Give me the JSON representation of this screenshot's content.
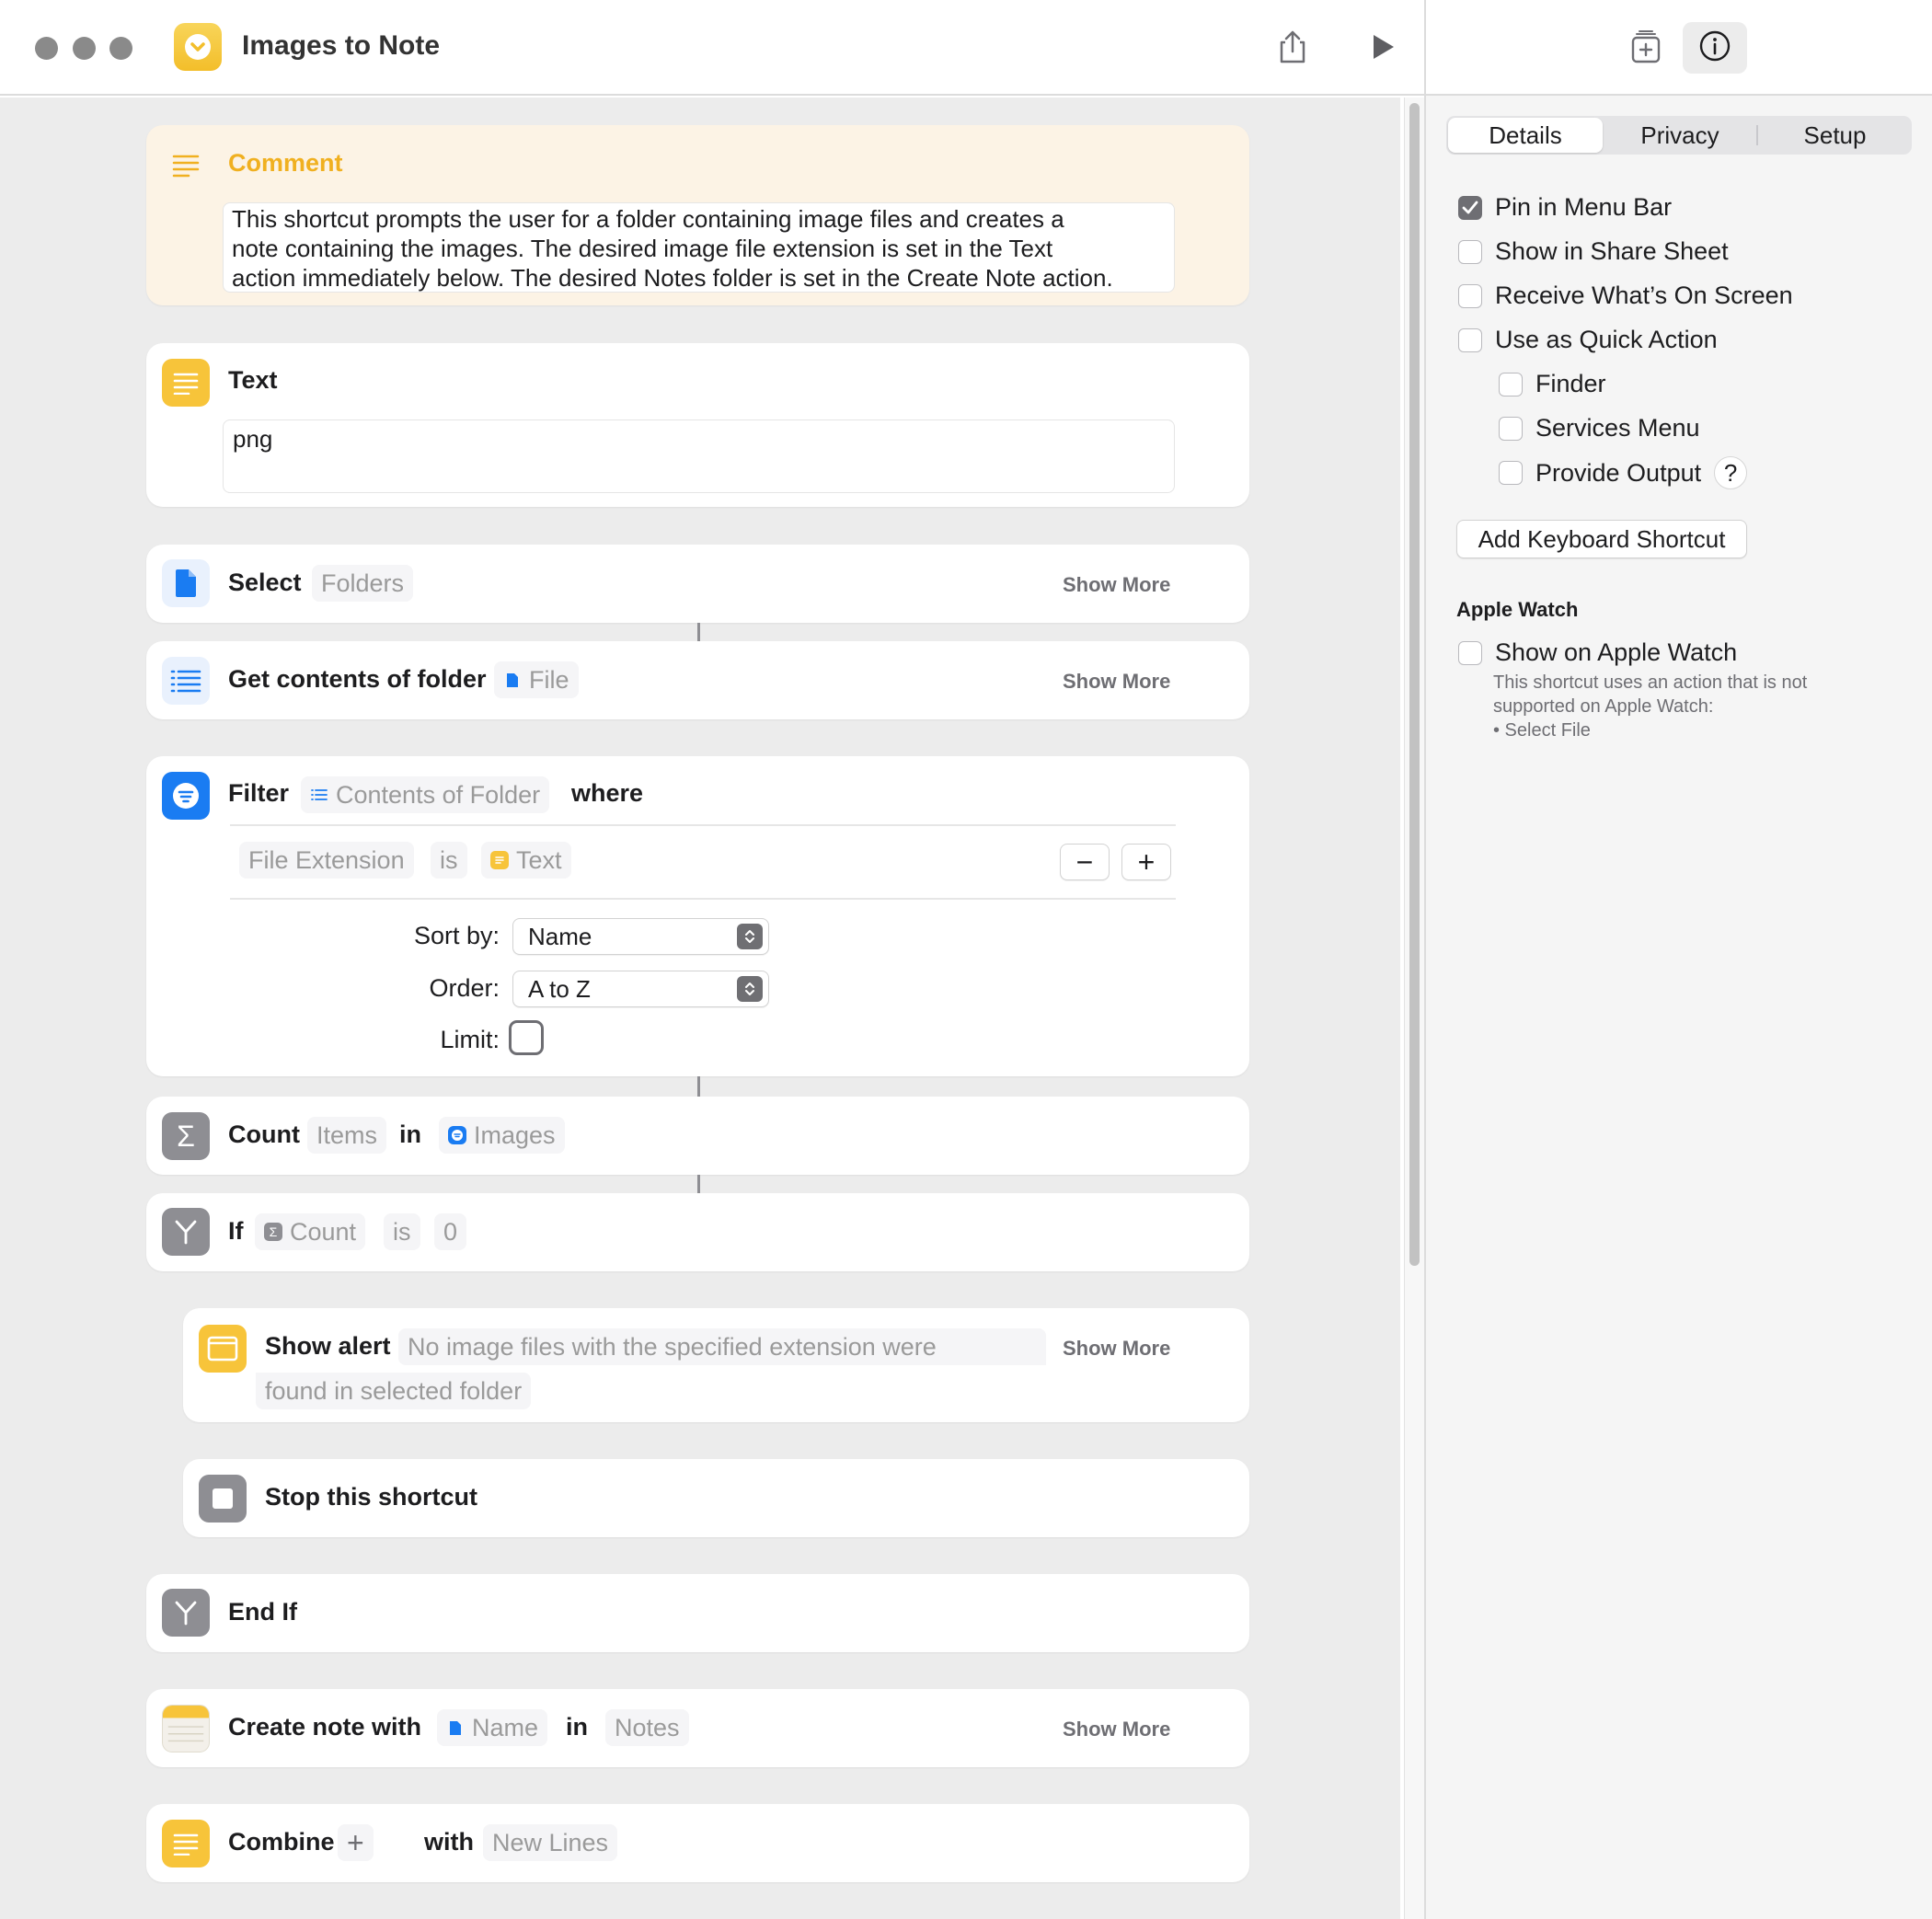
{
  "window": {
    "title": "Images to Note"
  },
  "comment": {
    "title": "Comment",
    "lines": [
      "This shortcut prompts the user for a folder containing image files and creates a",
      "note containing the images. The desired image file extension is set in the Text",
      "action immediately below. The desired Notes folder is set in the Create Note action."
    ]
  },
  "text_action": {
    "title": "Text",
    "value": "png"
  },
  "select_action": {
    "title": "Select",
    "param": "Folders",
    "show_more": "Show More"
  },
  "get_contents": {
    "title": "Get contents of folder",
    "param": "File",
    "show_more": "Show More"
  },
  "filter": {
    "title": "Filter",
    "param": "Contents of Folder",
    "where": "where",
    "condition": {
      "property": "File Extension",
      "op": "is",
      "value": "Text"
    },
    "minus": "−",
    "plus": "+",
    "sort_label": "Sort by:",
    "sort_value": "Name",
    "order_label": "Order:",
    "order_value": "A to Z",
    "limit_label": "Limit:"
  },
  "count_action": {
    "title": "Count",
    "param": "Items",
    "in": "in",
    "target": "Images"
  },
  "if_action": {
    "title": "If",
    "param": "Count",
    "op": "is",
    "value": "0"
  },
  "show_alert": {
    "title": "Show alert",
    "line1": "No image files with the specified extension were",
    "line2": "found in selected folder",
    "show_more": "Show More"
  },
  "stop_action": {
    "title": "Stop this shortcut"
  },
  "end_if": {
    "title": "End If"
  },
  "create_note": {
    "title": "Create note with",
    "param": "Name",
    "in": "in",
    "folder": "Notes",
    "show_more": "Show More"
  },
  "combine": {
    "title": "Combine",
    "plus": "+",
    "with": "with",
    "separator": "New Lines"
  },
  "sidebar": {
    "tabs": [
      "Details",
      "Privacy",
      "Setup"
    ],
    "options": [
      {
        "label": "Pin in Menu Bar",
        "checked": true
      },
      {
        "label": "Show in Share Sheet",
        "checked": false
      },
      {
        "label": "Receive What’s On Screen",
        "checked": false
      },
      {
        "label": "Use as Quick Action",
        "checked": false
      }
    ],
    "quick_action_options": [
      {
        "label": "Finder",
        "checked": false
      },
      {
        "label": "Services Menu",
        "checked": false
      },
      {
        "label": "Provide Output",
        "checked": false
      }
    ],
    "help": "?",
    "keyboard_button": "Add Keyboard Shortcut",
    "apple_watch": {
      "heading": "Apple Watch",
      "option": "Show on Apple Watch",
      "note_lines": [
        "This shortcut uses an action that is not",
        "supported on Apple Watch:",
        "• Select File"
      ]
    }
  },
  "colors": {
    "accent_yellow": "#f7c43a",
    "accent_blue": "#1a7cf2",
    "comment_bg": "#fcf3e5",
    "comment_title": "#f0b020"
  }
}
